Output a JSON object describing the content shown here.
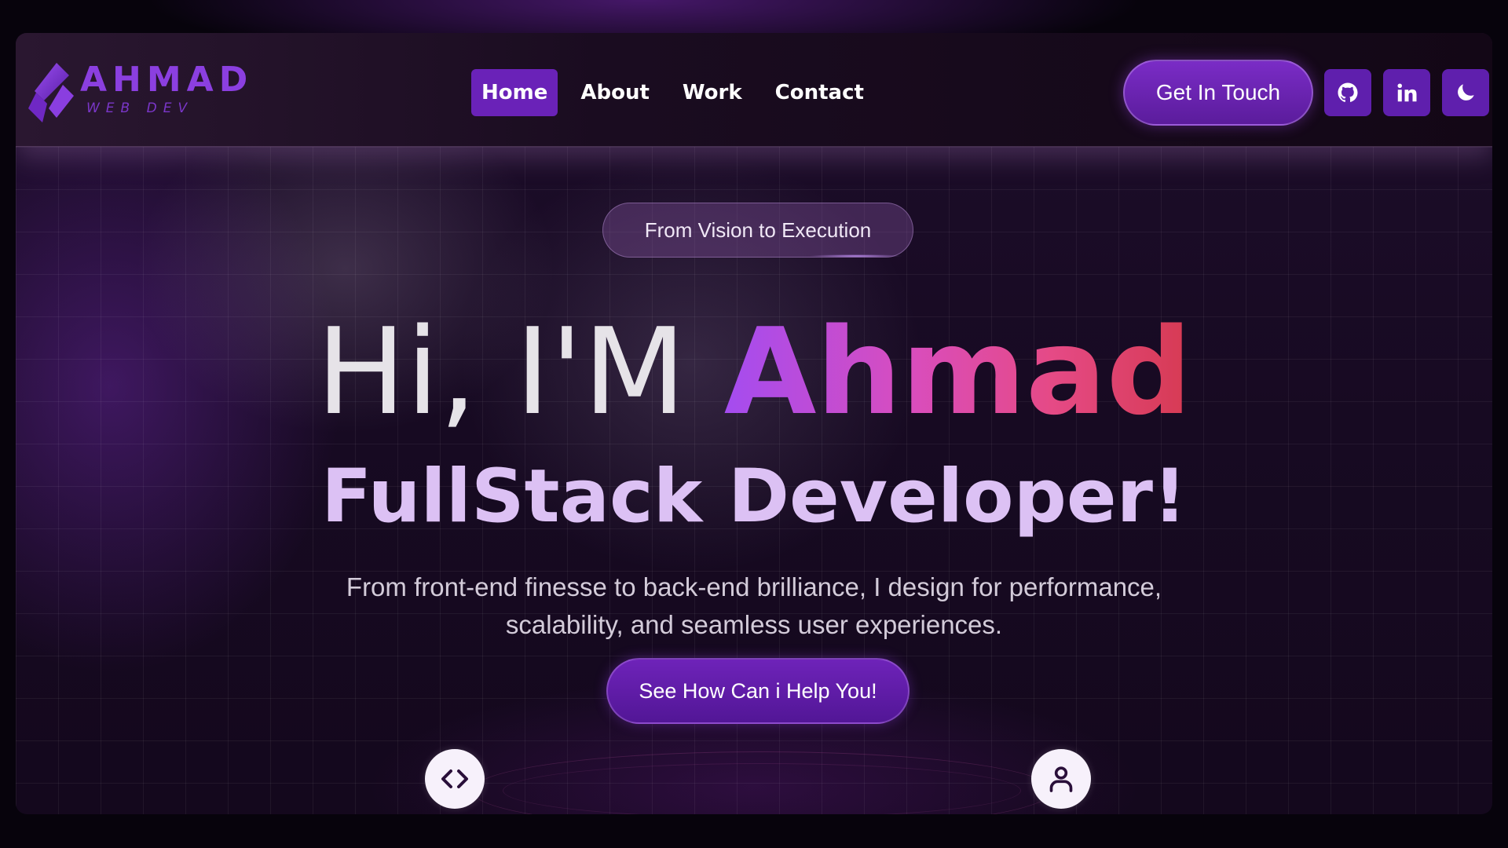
{
  "logo": {
    "title": "AHMAD",
    "subtitle": "WEB DEV"
  },
  "nav": {
    "items": [
      {
        "label": "Home",
        "active": true
      },
      {
        "label": "About",
        "active": false
      },
      {
        "label": "Work",
        "active": false
      },
      {
        "label": "Contact",
        "active": false
      }
    ]
  },
  "header": {
    "cta_label": "Get In Touch",
    "icons": [
      "github-icon",
      "linkedin-icon",
      "moon-icon"
    ]
  },
  "hero": {
    "badge": "From Vision to Execution",
    "greeting": "Hi, I'M ",
    "name": "Ahmad",
    "role": "FullStack Developer!",
    "description": "From front-end finesse to back-end brilliance, I design for performance, scalability, and seamless user experiences.",
    "button_label": "See How Can i Help You!",
    "orbit_icons": [
      "code-icon",
      "user-icon"
    ]
  },
  "colors": {
    "accent": "#6a22b8",
    "brand": "#8b3fe0",
    "name_gradient": [
      "#a44cf0",
      "#d94dbd",
      "#e54a86",
      "#d63a52"
    ],
    "role_text": "#dcc1f4",
    "background": "#170a22"
  }
}
